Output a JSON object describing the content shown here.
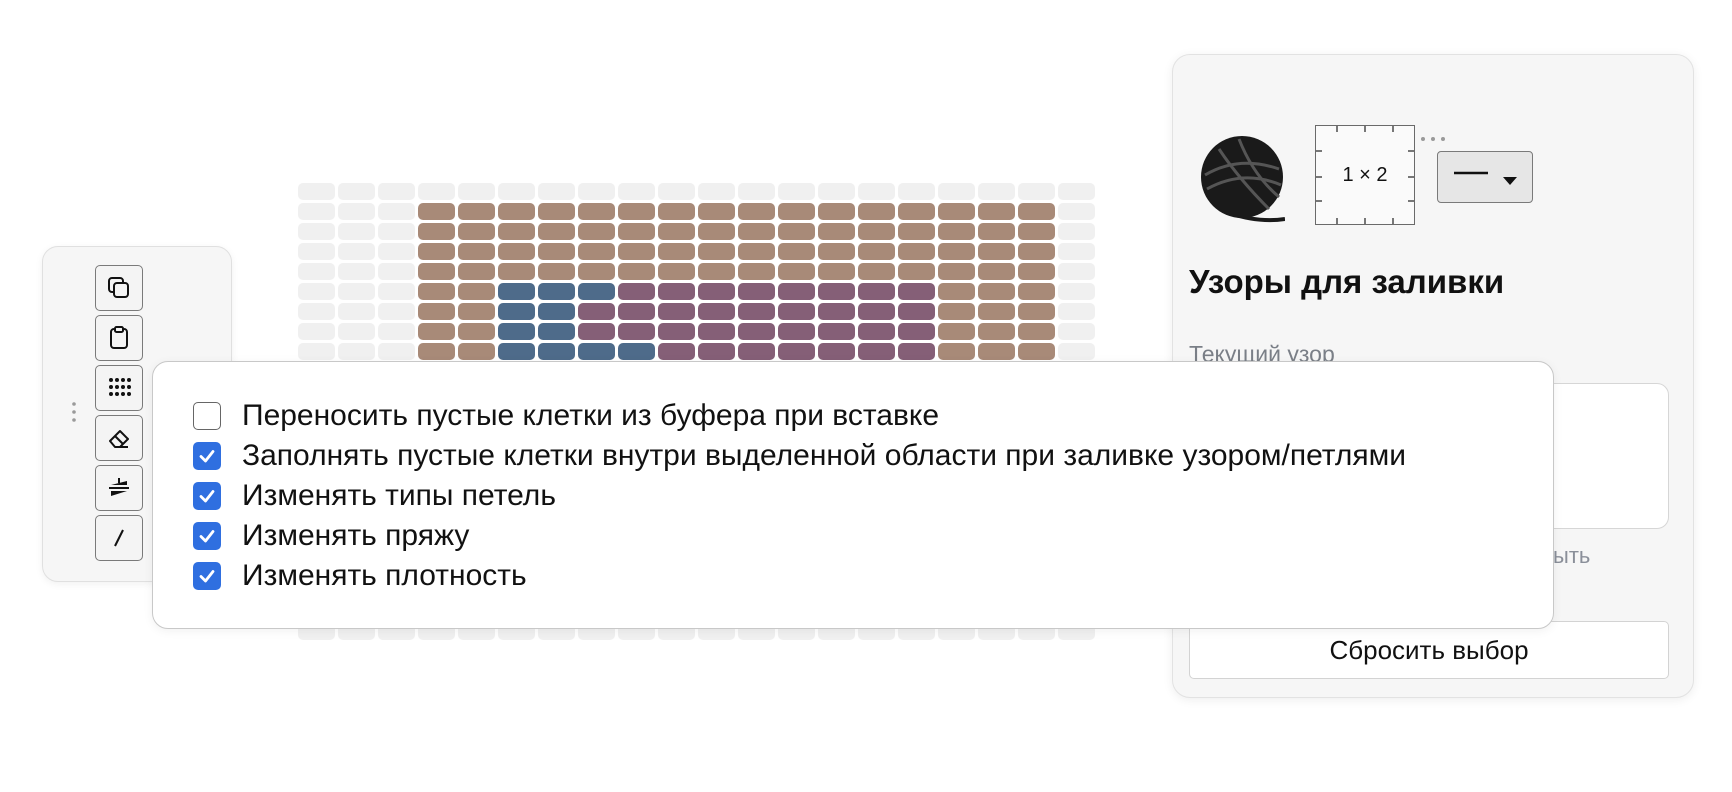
{
  "grid": {
    "columns": 20,
    "rows": [
      "....................",
      "...bbbbbbbbbbbbbbbb.",
      "...bbbbbbbbbbbbbbbb.",
      "...bbbbbbbbbbbbbbbb.",
      "...bbbbbbbbbbbbbbbb.",
      "...bblllmmmmmmmmbbb.",
      "...bbllmmmmmmmmmbbb.",
      "...bbllmmmmmmmmmbbb.",
      "...bbllllmmmmmmmbbb.",
      "....................",
      "....................",
      "....................",
      "....................",
      "....................",
      "....................",
      "....................",
      "....................",
      "....................",
      "....................",
      "....................",
      "....................",
      "....................",
      "...................."
    ],
    "colors": {
      "empty": "#f0f0f0",
      "b": "#a88a78",
      "l": "#4e6b8a",
      "m": "#855f77"
    }
  },
  "toolbar": {
    "buttons": [
      {
        "name": "copy-button",
        "icon": "copy-icon"
      },
      {
        "name": "paste-button",
        "icon": "clipboard-icon"
      },
      {
        "name": "pattern-fill-button",
        "icon": "dots-grid-icon"
      },
      {
        "name": "eraser-button",
        "icon": "eraser-icon"
      },
      {
        "name": "mirror-button",
        "icon": "mirror-icon"
      },
      {
        "name": "line-button",
        "icon": "line-icon"
      }
    ]
  },
  "panel": {
    "gauge_label": "1 × 2",
    "title": "Узоры для заливки",
    "current_pattern_label": "Текущий узор",
    "hidden_action_fragment": "ыть",
    "reset_label": "Сбросить выбор"
  },
  "options": [
    {
      "label": "Переносить пустые клетки из буфера при вставке",
      "checked": false
    },
    {
      "label": "Заполнять пустые клетки внутри выделенной области при заливке узором/петлями",
      "checked": true
    },
    {
      "label": "Изменять типы петель",
      "checked": true
    },
    {
      "label": "Изменять пряжу",
      "checked": true
    },
    {
      "label": "Изменять плотность",
      "checked": true
    }
  ],
  "accent_color": "#2f6fe0"
}
